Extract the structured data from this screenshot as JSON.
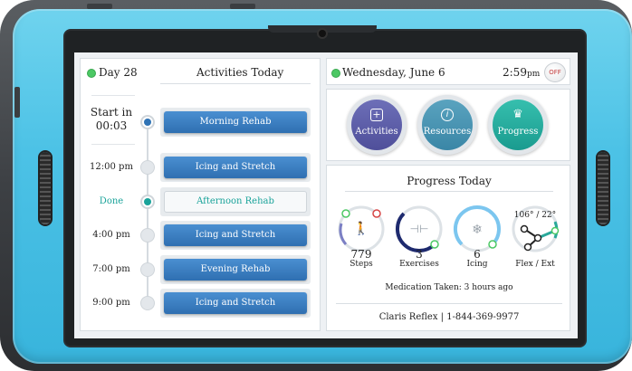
{
  "header_left": {
    "day": "Day 28",
    "title": "Activities Today"
  },
  "timeline": [
    {
      "time": "Start in 00:03",
      "time_line1": "Start in",
      "time_line2": "00:03",
      "activity": "Morning Rehab",
      "state": "next"
    },
    {
      "time": "12:00 pm",
      "activity": "Icing and Stretch",
      "state": "pending"
    },
    {
      "time": "Done",
      "activity": "Afternoon Rehab",
      "state": "done"
    },
    {
      "time": "4:00 pm",
      "activity": "Icing and Stretch",
      "state": "pending"
    },
    {
      "time": "7:00 pm",
      "activity": "Evening Rehab",
      "state": "pending"
    },
    {
      "time": "9:00 pm",
      "activity": "Icing and Stretch",
      "state": "pending"
    }
  ],
  "header_right": {
    "date": "Wednesday, June 6",
    "time": "2:59",
    "ampm": "pm",
    "power_label": "OFF"
  },
  "nav": {
    "activities": "Activities",
    "resources": "Resources",
    "progress": "Progress"
  },
  "progress": {
    "title": "Progress Today",
    "steps": {
      "value": "779",
      "label": "Steps",
      "icon": "walking-icon",
      "fraction": 0.2
    },
    "exercises": {
      "value": "3",
      "label": "Exercises",
      "icon": "dumbbell-icon",
      "fraction": 0.4
    },
    "icing": {
      "value": "6",
      "label": "Icing",
      "icon": "snowflake-icon",
      "fraction": 0.75
    },
    "flex": {
      "value": "106° / 22°",
      "label": "Flex / Ext",
      "icon": "knee-angle-icon"
    },
    "medication": "Medication Taken: 3 hours ago",
    "contact": "Claris Reflex | 1-844-369-9977"
  },
  "colors": {
    "accent_blue": "#2f6fb1",
    "teal": "#1aa39a",
    "bezel": "#4cc2e6",
    "status_green": "#4cc864",
    "alert_red": "#c23a3a"
  }
}
